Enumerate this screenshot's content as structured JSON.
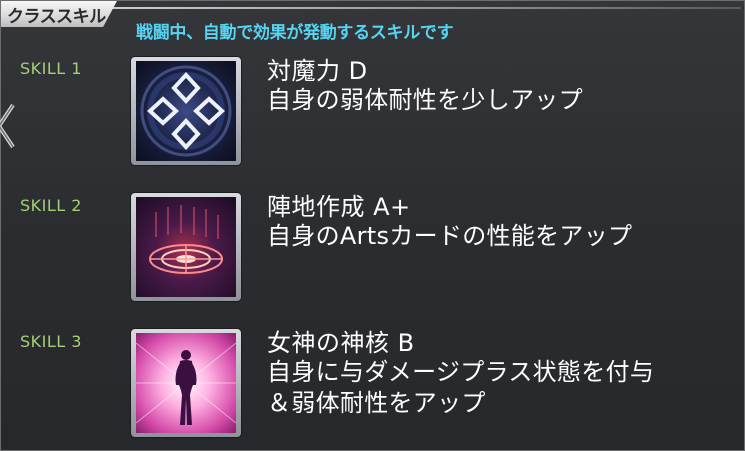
{
  "header": {
    "title": "クラススキル",
    "subtitle": "戦闘中、自動で効果が発動するスキルです"
  },
  "skills": [
    {
      "label": "SKILL 1",
      "name": "対魔力 D",
      "description_lines": [
        "自身の弱体耐性を少しアップ"
      ],
      "icon": "magic-resistance-icon"
    },
    {
      "label": "SKILL 2",
      "name": "陣地作成 A+",
      "description_lines": [
        "自身のArtsカードの性能をアップ"
      ],
      "icon": "territory-creation-icon"
    },
    {
      "label": "SKILL 3",
      "name": "女神の神核 B",
      "description_lines": [
        "自身に与ダメージプラス状態を付与",
        "＆弱体耐性をアップ"
      ],
      "icon": "goddess-core-icon"
    }
  ],
  "colors": {
    "subtitle": "#56d4f2",
    "skill_label": "#a6cf78",
    "text": "#ffffff",
    "panel_bg": "#2b2d30"
  }
}
